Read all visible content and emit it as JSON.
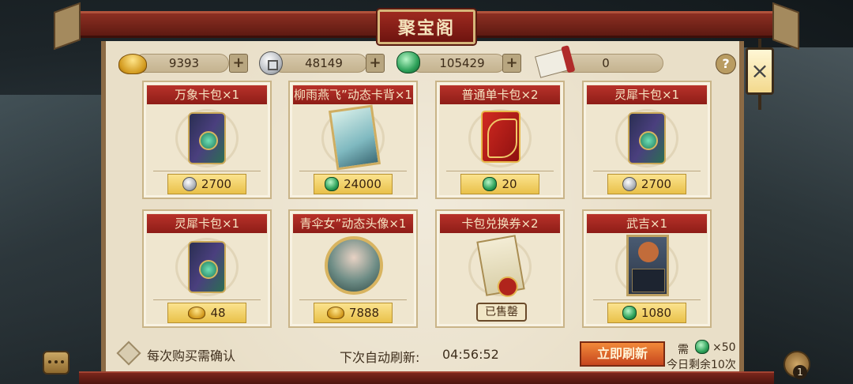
{
  "title": "聚宝阁",
  "currencies": {
    "gold": {
      "icon": "gold-ingot-icon",
      "value": "9393"
    },
    "silver": {
      "icon": "silver-coin-icon",
      "value": "48149"
    },
    "jade": {
      "icon": "jade-icon",
      "value": "105429"
    },
    "scroll": {
      "icon": "scroll-icon",
      "value": "0"
    },
    "plus": "+"
  },
  "help": "?",
  "close": "×",
  "items": [
    {
      "title": "万象卡包×1",
      "price": "2700",
      "currency": "silver"
    },
    {
      "title": "柳雨燕飞”动态卡背×1",
      "price": "24000",
      "currency": "jade"
    },
    {
      "title": "普通单卡包×2",
      "price": "20",
      "currency": "jade"
    },
    {
      "title": "灵犀卡包×1",
      "price": "2700",
      "currency": "silver"
    },
    {
      "title": "灵犀卡包×1",
      "price": "48",
      "currency": "gold"
    },
    {
      "title": "青伞女”动态头像×1",
      "price": "7888",
      "currency": "gold"
    },
    {
      "title": "卡包兑换券×2",
      "price": "",
      "currency": "",
      "sold": "已售罄"
    },
    {
      "title": "武吉×1",
      "price": "1080",
      "currency": "jade"
    }
  ],
  "footer": {
    "confirm_label": "每次购买需确认",
    "refresh_label": "下次自动刷新:",
    "refresh_time": "04:56:52",
    "refresh_button": "立即刷新",
    "need_label": "需",
    "need_count": "×50",
    "remain_label": "今日剩余10次"
  },
  "bag_count": "1",
  "colors": {
    "title_red": "#8e1d17",
    "panel_bg": "#e9dfc8",
    "price_gold": "#e9c14a",
    "refresh_orange": "#c6451e"
  }
}
